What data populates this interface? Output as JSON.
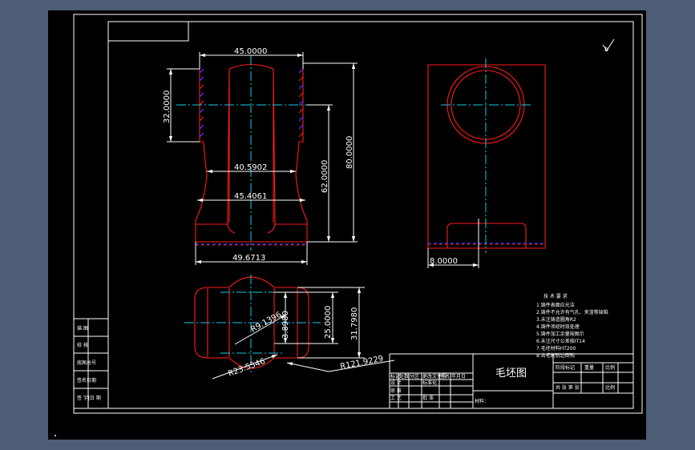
{
  "drawing": {
    "title": "毛坯图",
    "roughness_mark": "b"
  },
  "dimensions": {
    "top_width": "45.0000",
    "left_height": "32.0000",
    "neck_width": "40.5902",
    "mid_width": "45.4061",
    "base_width": "49.6713",
    "height_62": "62.0000",
    "height_80": "80.0000",
    "side_offset": "8.0000",
    "top_h1": "3.8980",
    "top_h2": "25.0000",
    "top_h3": "31.7980",
    "radius_r9": "R9.1396",
    "radius_r23": "R23.5546",
    "radius_r121": "R121.9229"
  },
  "notes": {
    "heading": "技 术 要 求",
    "lines": [
      "1.铸件表面应光洁",
      "2.铸件不允许有气孔、夹渣等缺陷",
      "3.未注铸造圆角R2",
      "4.铸件须经时效处理",
      "5.铸件加工余量按图示",
      "6.未注尺寸公差按IT14",
      "7.毛坯材料HT200",
      "8.去毛刺锐边倒钝"
    ]
  },
  "left_table": {
    "rows": [
      "描 图",
      "校 核",
      "底图总号",
      "签名日期",
      "签 字|日 期"
    ]
  },
  "title_block": {
    "header_cells": [
      "标记",
      "处数",
      "分区",
      "更改文件号",
      "签名",
      "年月日"
    ],
    "left_rows": [
      [
        "设 计",
        "",
        "标准化",
        ""
      ],
      [
        "审 核",
        "",
        "",
        ""
      ],
      [
        "工 艺",
        "",
        "批 准",
        ""
      ]
    ],
    "right_top_cells": [
      "阶段标记",
      "重量",
      "比例"
    ],
    "sheet_text": "共 张 第 张",
    "scale_label": "比例",
    "material_label": "材料："
  }
}
